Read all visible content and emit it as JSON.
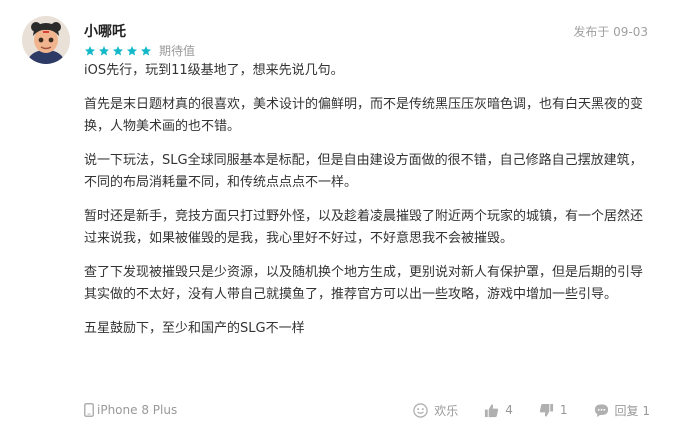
{
  "review": {
    "username": "小哪吒",
    "posted": "发布于 09-03",
    "rating_stars": 5,
    "rating_label": "期待值",
    "paragraphs": [
      "iOS先行，玩到11级基地了，想来先说几句。",
      "首先是末日题材真的很喜欢，美术设计的偏鲜明，而不是传统黑压压灰暗色调，也有白天黑夜的变换，人物美术画的也不错。",
      "说一下玩法，SLG全球同服基本是标配，但是自由建设方面做的很不错，自己修路自己摆放建筑，不同的布局消耗量不同，和传统点点点不一样。",
      "暂时还是新手，竞技方面只打过野外怪，以及趁着凌晨摧毁了附近两个玩家的城镇，有一个居然还过来说我，如果被催毁的是我，我心里好不好过，不好意思我不会被摧毁。",
      "查了下发现被摧毁只是少资源，以及随机换个地方生成，更别说对新人有保护罩，但是后期的引导其实做的不太好，没有人带自己就摸鱼了，推荐官方可以出一些攻略，游戏中增加一些引导。",
      "五星鼓励下，至少和国产的SLG不一样"
    ],
    "device": "iPhone 8 Plus"
  },
  "actions": {
    "happy_label": "欢乐",
    "like_count": "4",
    "dislike_count": "1",
    "reply_label": "回复 1"
  },
  "colors": {
    "star": "#14b9c8",
    "icon": "#b0b0b0"
  }
}
